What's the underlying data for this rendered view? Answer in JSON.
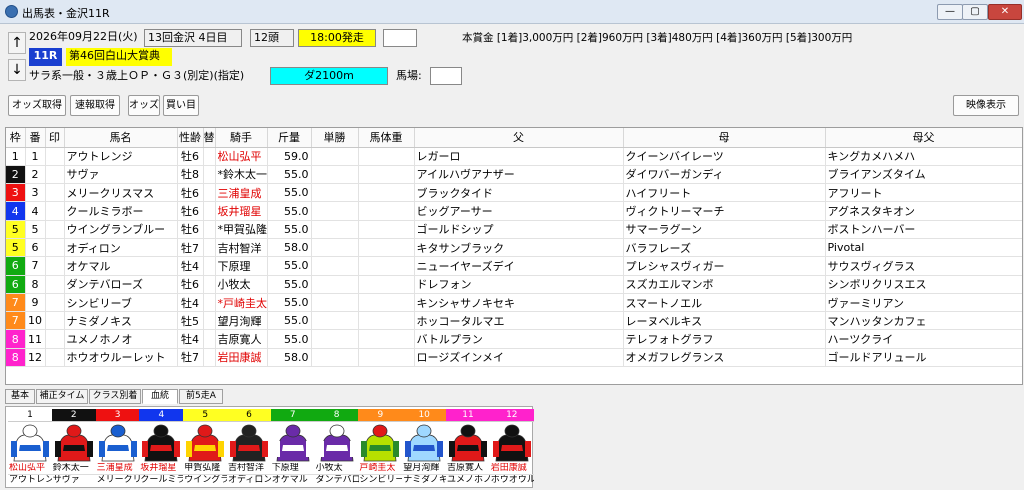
{
  "window": {
    "title": "出馬表・金沢11R",
    "min": "—",
    "max": "▢",
    "close": "✕"
  },
  "race": {
    "date": "2026年09月22日(火)",
    "meeting": "13回金沢 4日目",
    "heads": "12頭",
    "start": "18:00発走",
    "number": "11R",
    "name": "第46回白山大賞典",
    "condition": "サラ系一般・３歳上ＯＰ・Ｇ３(別定)(指定)",
    "course": "ダ2100m",
    "baba_label": "馬場:",
    "prize": "本賞金 [1着]3,000万円 [2着]960万円 [3着]480万円 [4着]360万円 [5着]300万円"
  },
  "buttons": {
    "odds": "オッズ取得",
    "sokuho": "速報取得",
    "odds2": "オッズ",
    "buy": "買い目",
    "video": "映像表示"
  },
  "arrows": {
    "up": "↑",
    "down": "↓"
  },
  "colors": {
    "frames": [
      "#ffffff",
      "#111111",
      "#ee1111",
      "#1136ee",
      "#ffff22",
      "#ffff22",
      "#11aa11",
      "#11aa11",
      "#ff8a1a",
      "#ff8a1a",
      "#ff22cc",
      "#ff22cc"
    ],
    "frameText": [
      "#000000",
      "#ffffff",
      "#ffffff",
      "#ffffff",
      "#000000",
      "#000000",
      "#ffffff",
      "#ffffff",
      "#ffffff",
      "#ffffff",
      "#ffffff",
      "#ffffff"
    ]
  },
  "table": {
    "headers": [
      "枠",
      "番",
      "印",
      "馬名",
      "性齢",
      "替",
      "騎手",
      "斤量",
      "単勝",
      "馬体重",
      "父",
      "母",
      "母父"
    ],
    "rows": [
      {
        "waku": "1",
        "ban": "1",
        "mark": "",
        "name": "アウトレンジ",
        "sexage": "牡6",
        "change": "",
        "jockey": "松山弘平",
        "jred": true,
        "kin": "59.0",
        "win": "",
        "weight": "",
        "sire": "レガーロ",
        "dam": "クイーンバイレーツ",
        "bms": "キングカメハメハ"
      },
      {
        "waku": "2",
        "ban": "2",
        "mark": "",
        "name": "サヴァ",
        "sexage": "牡8",
        "change": "",
        "jockey": "*鈴木太一",
        "jred": false,
        "kin": "55.0",
        "win": "",
        "weight": "",
        "sire": "アイルハヴアナザー",
        "dam": "ダイワバーガンディ",
        "bms": "ブライアンズタイム"
      },
      {
        "waku": "3",
        "ban": "3",
        "mark": "",
        "name": "メリークリスマス",
        "sexage": "牡6",
        "change": "",
        "jockey": "三浦皇成",
        "jred": true,
        "kin": "55.0",
        "win": "",
        "weight": "",
        "sire": "ブラックタイド",
        "dam": "ハイフリート",
        "bms": "アフリート"
      },
      {
        "waku": "4",
        "ban": "4",
        "mark": "",
        "name": "クールミラボー",
        "sexage": "牡6",
        "change": "",
        "jockey": "坂井瑠星",
        "jred": true,
        "kin": "55.0",
        "win": "",
        "weight": "",
        "sire": "ビッグアーサー",
        "dam": "ヴィクトリーマーチ",
        "bms": "アグネスタキオン"
      },
      {
        "waku": "5",
        "ban": "5",
        "mark": "",
        "name": "ウイングランブルー",
        "sexage": "牡6",
        "change": "",
        "jockey": "*甲賀弘隆",
        "jred": false,
        "kin": "55.0",
        "win": "",
        "weight": "",
        "sire": "ゴールドシップ",
        "dam": "サマーラグーン",
        "bms": "ボストンハーバー"
      },
      {
        "waku": "5",
        "ban": "6",
        "mark": "",
        "name": "オディロン",
        "sexage": "牡7",
        "change": "",
        "jockey": "吉村智洋",
        "jred": false,
        "kin": "58.0",
        "win": "",
        "weight": "",
        "sire": "キタサンブラック",
        "dam": "バラフレーズ",
        "bms": "Pivotal"
      },
      {
        "waku": "6",
        "ban": "7",
        "mark": "",
        "name": "オケマル",
        "sexage": "牡4",
        "change": "",
        "jockey": "下原理",
        "jred": false,
        "kin": "55.0",
        "win": "",
        "weight": "",
        "sire": "ニューイヤーズデイ",
        "dam": "プレシャスヴィガー",
        "bms": "サウスヴィグラス"
      },
      {
        "waku": "6",
        "ban": "8",
        "mark": "",
        "name": "ダンテバローズ",
        "sexage": "牡6",
        "change": "",
        "jockey": "小牧太",
        "jred": false,
        "kin": "55.0",
        "win": "",
        "weight": "",
        "sire": "ドレフォン",
        "dam": "スズカエルマンボ",
        "bms": "シンボリクリスエス"
      },
      {
        "waku": "7",
        "ban": "9",
        "mark": "",
        "name": "シンビリーブ",
        "sexage": "牡4",
        "change": "",
        "jockey": "*戸崎圭太",
        "jred": true,
        "kin": "55.0",
        "win": "",
        "weight": "",
        "sire": "キンシャサノキセキ",
        "dam": "スマートノエル",
        "bms": "ヴァーミリアン"
      },
      {
        "waku": "7",
        "ban": "10",
        "mark": "",
        "name": "ナミダノキス",
        "sexage": "牡5",
        "change": "",
        "jockey": "望月洵輝",
        "jred": false,
        "kin": "55.0",
        "win": "",
        "weight": "",
        "sire": "ホッコータルマエ",
        "dam": "レーヌベルキス",
        "bms": "マンハッタンカフェ"
      },
      {
        "waku": "8",
        "ban": "11",
        "mark": "",
        "name": "ユメノホノオ",
        "sexage": "牡4",
        "change": "",
        "jockey": "吉原寛人",
        "jred": false,
        "kin": "55.0",
        "win": "",
        "weight": "",
        "sire": "バトルプラン",
        "dam": "テレフォトグラフ",
        "bms": "ハーツクライ"
      },
      {
        "waku": "8",
        "ban": "12",
        "mark": "",
        "name": "ホウオウルーレット",
        "sexage": "牡7",
        "change": "",
        "jockey": "岩田康誠",
        "jred": true,
        "kin": "58.0",
        "win": "",
        "weight": "",
        "sire": "ロージズインメイ",
        "dam": "オメガフレグランス",
        "bms": "ゴールドアリュール"
      }
    ]
  },
  "tabs": [
    "基本",
    "補正タイム",
    "クラス別着",
    "血統",
    "前5走A"
  ],
  "selected_tab": "血統",
  "silks": [
    {
      "num": "1",
      "jockey": "松山弘平",
      "horse": "アウトレンジ",
      "jred": true,
      "body": "#ffffff",
      "accent": "#1a5fd0",
      "cap": "#ffffff"
    },
    {
      "num": "2",
      "jockey": "鈴木太一",
      "horse": "サヴァ",
      "jred": false,
      "body": "#e01919",
      "accent": "#111111",
      "cap": "#e01919"
    },
    {
      "num": "3",
      "jockey": "三浦皇成",
      "horse": "メリークリ",
      "jred": true,
      "body": "#ffffff",
      "accent": "#1a5fd0",
      "cap": "#1a5fd0"
    },
    {
      "num": "4",
      "jockey": "坂井瑠星",
      "horse": "クールミラ",
      "jred": true,
      "body": "#111111",
      "accent": "#e01919",
      "cap": "#111111"
    },
    {
      "num": "5",
      "jockey": "甲賀弘隆",
      "horse": "ウイングラ",
      "jred": false,
      "body": "#e01919",
      "accent": "#ffd400",
      "cap": "#e01919"
    },
    {
      "num": "6",
      "jockey": "吉村智洋",
      "horse": "オディロン",
      "jred": false,
      "body": "#222222",
      "accent": "#e01919",
      "cap": "#222222"
    },
    {
      "num": "7",
      "jockey": "下原理",
      "horse": "オケマル",
      "jred": false,
      "body": "#6a2ba8",
      "accent": "#ffffff",
      "cap": "#6a2ba8"
    },
    {
      "num": "8",
      "jockey": "小牧太",
      "horse": "ダンテバロ",
      "jred": false,
      "body": "#6a2ba8",
      "accent": "#ffffff",
      "cap": "#ffffff"
    },
    {
      "num": "9",
      "jockey": "戸崎圭太",
      "horse": "シンビリー",
      "jred": true,
      "body": "#b8e000",
      "accent": "#2a8a2a",
      "cap": "#e01919"
    },
    {
      "num": "10",
      "jockey": "望月洵輝",
      "horse": "ナミダノキ",
      "jred": false,
      "body": "#9fd8ff",
      "accent": "#2255cc",
      "cap": "#9fd8ff"
    },
    {
      "num": "11",
      "jockey": "吉原寛人",
      "horse": "ユメノホノ",
      "jred": false,
      "body": "#e01919",
      "accent": "#111111",
      "cap": "#111111"
    },
    {
      "num": "12",
      "jockey": "岩田康誠",
      "horse": "ホウオウル",
      "jred": true,
      "body": "#111111",
      "accent": "#e01919",
      "cap": "#111111"
    }
  ]
}
